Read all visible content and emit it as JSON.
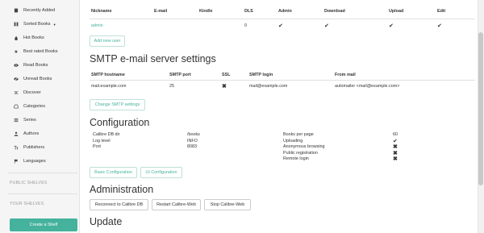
{
  "sidebar": {
    "items": [
      {
        "label": "Recently Added",
        "icon": "book-icon"
      },
      {
        "label": "Sorted Books",
        "icon": "sort-icon",
        "caret": true
      },
      {
        "label": "Hot Books",
        "icon": "fire-icon"
      },
      {
        "label": "Best rated Books",
        "icon": "star-icon"
      },
      {
        "label": "Read Books",
        "icon": "eye-icon"
      },
      {
        "label": "Unread Books",
        "icon": "eye-slash-icon"
      },
      {
        "label": "Discover",
        "icon": "shuffle-icon"
      },
      {
        "label": "Categories",
        "icon": "inbox-icon"
      },
      {
        "label": "Series",
        "icon": "list-icon"
      },
      {
        "label": "Authors",
        "icon": "user-icon"
      },
      {
        "label": "Publishers",
        "icon": "text-size-icon"
      },
      {
        "label": "Languages",
        "icon": "flag-icon"
      }
    ],
    "public_shelves": "PUBLIC SHELVES",
    "your_shelves": "YOUR SHELVES",
    "create_shelf": "Create a Shelf"
  },
  "users": {
    "headers": [
      "Nickname",
      "E-mail",
      "Kindle",
      "DLS",
      "Admin",
      "Download",
      "Upload",
      "Edit"
    ],
    "rows": [
      {
        "nickname": "admin",
        "email": "",
        "kindle": "",
        "dls": "0",
        "admin": "✔",
        "download": "✔",
        "upload": "✔",
        "edit": "✔"
      }
    ],
    "add_button": "Add new user"
  },
  "smtp": {
    "title": "SMTP e-mail server settings",
    "headers": [
      "SMTP hostname",
      "SMTP port",
      "SSL",
      "SMTP login",
      "From mail"
    ],
    "row": {
      "hostname": "mail.example.com",
      "port": "25",
      "ssl": "✖",
      "login": "mail@example.com",
      "from": "automailer <mail@example.com>"
    },
    "change_button": "Change SMTP settings"
  },
  "configuration": {
    "title": "Configuration",
    "left": [
      {
        "label": "Calibre DB dir",
        "value": "/books"
      },
      {
        "label": "Log level",
        "value": "INFO"
      },
      {
        "label": "Port",
        "value": "8083"
      }
    ],
    "right": [
      {
        "label": "Books per page",
        "value": "60"
      },
      {
        "label": "Uploading",
        "value": "✔"
      },
      {
        "label": "Anonymous browsing",
        "value": "✖"
      },
      {
        "label": "Public registration",
        "value": "✖"
      },
      {
        "label": "Remote login",
        "value": "✖"
      }
    ],
    "basic_button": "Basic Configuration",
    "ui_button": "UI Configuration"
  },
  "administration": {
    "title": "Administration",
    "reconnect_button": "Reconnect to Calibre DB",
    "restart_button": "Restart Calibre-Web",
    "stop_button": "Stop Calibre-Web"
  },
  "update": {
    "title": "Update"
  },
  "colors": {
    "accent": "#45b29d",
    "sidebar_bg": "#f5f5f5"
  }
}
